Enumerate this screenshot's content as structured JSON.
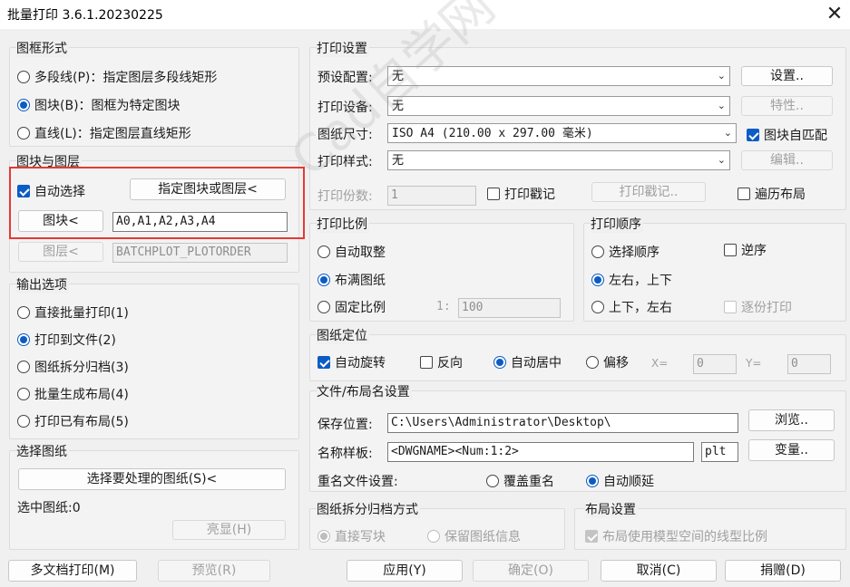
{
  "window": {
    "title": "批量打印 3.6.1.20230225",
    "close_glyph": "✕"
  },
  "frame_style": {
    "label": "图框形式",
    "options": [
      {
        "label": "多段线(P)：指定图层多段线矩形",
        "selected": false
      },
      {
        "label": "图块(B)：图框为特定图块",
        "selected": true
      },
      {
        "label": "直线(L)：指定图层直线矩形",
        "selected": false
      }
    ]
  },
  "block_layer": {
    "label": "图块与图层",
    "auto_select": "自动选择",
    "specify_button": "指定图块或图层<",
    "block_button": "图块<",
    "block_value": "A0,A1,A2,A3,A4",
    "layer_button": "图层<",
    "layer_value": "BATCHPLOT_PLOTORDER"
  },
  "output": {
    "label": "输出选项",
    "options": [
      {
        "label": "直接批量打印(1)",
        "selected": false
      },
      {
        "label": "打印到文件(2)",
        "selected": true
      },
      {
        "label": "图纸拆分归档(3)",
        "selected": false
      },
      {
        "label": "批量生成布局(4)",
        "selected": false
      },
      {
        "label": "打印已有布局(5)",
        "selected": false
      }
    ]
  },
  "select_drawings": {
    "label": "选择图纸",
    "select_button": "选择要处理的图纸(S)<",
    "selected_count": "选中图纸:0",
    "highlight_button": "亮显(H)"
  },
  "print_settings": {
    "label": "打印设置",
    "preset_label": "预设配置:",
    "preset_value": "无",
    "settings_button": "设置..",
    "device_label": "打印设备:",
    "device_value": "无",
    "properties_button": "特性..",
    "paper_label": "图纸尺寸:",
    "paper_value": "ISO A4 (210.00 x 297.00 毫米)",
    "block_auto_match": "图块自匹配",
    "style_label": "打印样式:",
    "style_value": "无",
    "edit_button": "编辑..",
    "copies_label": "打印份数:",
    "copies_value": "1",
    "stamp_check": "打印戳记",
    "stamp_button": "打印戳记..",
    "traverse_layout": "遍历布局"
  },
  "scale": {
    "label": "打印比例",
    "options": [
      {
        "label": "自动取整",
        "selected": false
      },
      {
        "label": "布满图纸",
        "selected": true
      },
      {
        "label": "固定比例",
        "selected": false
      }
    ],
    "ratio_prefix": "1:",
    "ratio_value": "100"
  },
  "order": {
    "label": "打印顺序",
    "options": [
      {
        "label": "选择顺序",
        "selected": false
      },
      {
        "label": "左右，上下",
        "selected": true
      },
      {
        "label": "上下，左右",
        "selected": false
      }
    ],
    "reverse": "逆序",
    "copy_by_copy": "逐份打印"
  },
  "position": {
    "label": "图纸定位",
    "auto_rotate": "自动旋转",
    "reverse": "反向",
    "auto_center": "自动居中",
    "offset": "偏移",
    "x_label": "X=",
    "x_value": "0",
    "y_label": "Y=",
    "y_value": "0"
  },
  "filename": {
    "label": "文件/布局名设置",
    "save_label": "保存位置:",
    "save_value": "C:\\Users\\Administrator\\Desktop\\",
    "browse_button": "浏览..",
    "name_label": "名称样板:",
    "name_value": "<DWGNAME><Num:1:2>",
    "ext_value": "plt",
    "variable_button": "变量..",
    "rename_label": "重名文件设置:",
    "overwrite": "覆盖重名",
    "auto_increment": "自动顺延"
  },
  "archive": {
    "label": "图纸拆分归档方式",
    "write_block": "直接写块",
    "keep_info": "保留图纸信息"
  },
  "layout": {
    "label": "布局设置",
    "use_model_ltscale": "布局使用模型空间的线型比例"
  },
  "bottom": {
    "multi_doc": "多文档打印(M)",
    "preview": "预览(R)",
    "apply": "应用(Y)",
    "ok": "确定(O)",
    "cancel": "取消(C)",
    "donate": "捐赠(D)"
  },
  "watermark_text": "Cad自学网 www.cadzxw.com",
  "colors": {
    "accent": "#0b5cc5",
    "highlight_frame": "#e53935"
  }
}
